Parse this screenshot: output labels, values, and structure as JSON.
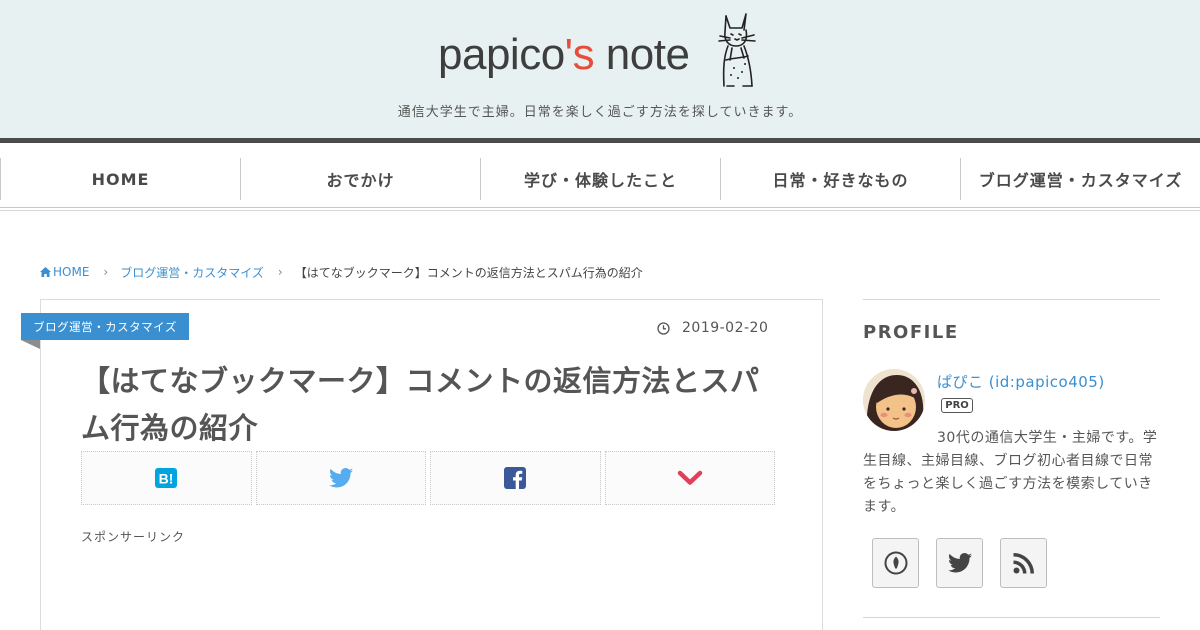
{
  "header": {
    "brand_main": "papico",
    "brand_accent": "'s",
    "brand_rest": " note",
    "tagline": "通信大学生で主婦。日常を楽しく過ごす方法を探していきます。"
  },
  "nav": {
    "items": [
      {
        "label": "HOME"
      },
      {
        "label": "おでかけ"
      },
      {
        "label": "学び・体験したこと"
      },
      {
        "label": "日常・好きなもの"
      },
      {
        "label": "ブログ運営・カスタマイズ"
      }
    ]
  },
  "breadcrumb": {
    "home": "HOME",
    "category": "ブログ運営・カスタマイズ",
    "current": "【はてなブックマーク】コメントの返信方法とスパム行為の紹介"
  },
  "article": {
    "category": "ブログ運営・カスタマイズ",
    "date": "2019-02-20",
    "title": "【はてなブックマーク】コメントの返信方法とスパム行為の紹介",
    "sponsor": "スポンサーリンク"
  },
  "share": {
    "icons": [
      "hatena-bookmark-icon",
      "twitter-icon",
      "facebook-icon",
      "pocket-icon"
    ],
    "colors": {
      "hatena": "#00a4de",
      "twitter": "#55acee",
      "facebook": "#3b5998",
      "pocket": "#e0405a"
    }
  },
  "sidebar": {
    "heading": "PROFILE",
    "name": "ぱぴこ (id:papico405)",
    "badge": "PRO",
    "description": "30代の通信大学生・主婦です。学生目線、主婦目線、ブログ初心者目線で日常をちょっと楽しく過ごす方法を模索していきます。",
    "follow_icons": [
      "hatena-blog-icon",
      "twitter-icon",
      "rss-icon"
    ]
  },
  "colors": {
    "accent": "#3a8fd1",
    "header_bg": "#e8f1f1",
    "brand_accent": "#e74c3c",
    "text": "#555555"
  }
}
